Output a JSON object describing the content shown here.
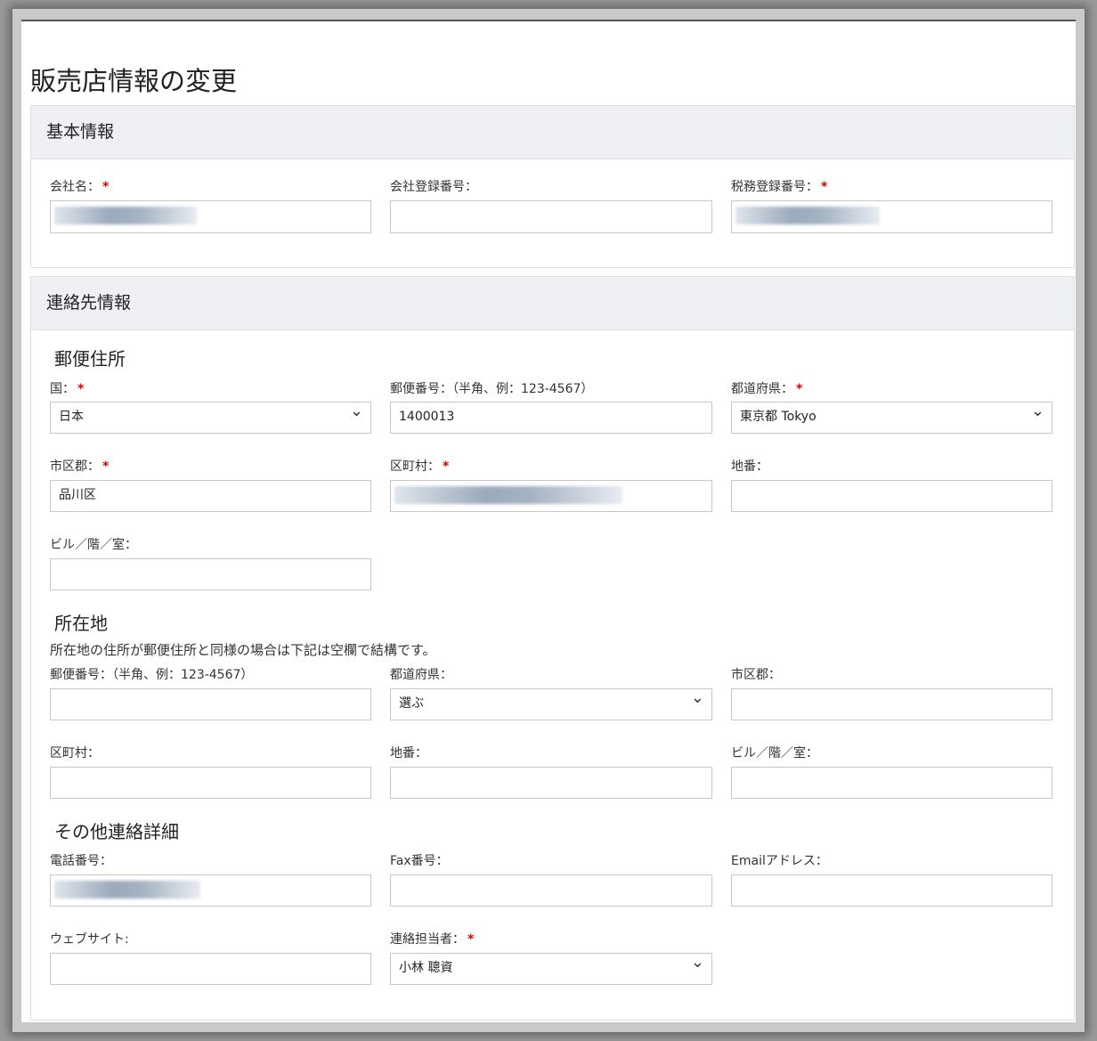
{
  "page_title": "販売店情報の変更",
  "basic": {
    "heading": "基本情報",
    "company_name": {
      "label": "会社名：",
      "value": ""
    },
    "company_reg_no": {
      "label": "会社登録番号：",
      "value": ""
    },
    "tax_reg_no": {
      "label": "税務登録番号：",
      "value": ""
    }
  },
  "contact": {
    "heading": "連絡先情報",
    "postal": {
      "heading": "郵便住所",
      "country": {
        "label": "国：",
        "value": "日本"
      },
      "zip": {
        "label": "郵便番号：（半角、例：123-4567）",
        "value": "1400013"
      },
      "prefecture": {
        "label": "都道府県：",
        "value": "東京都 Tokyo"
      },
      "city": {
        "label": "市区郡：",
        "value": "品川区"
      },
      "town": {
        "label": "区町村：",
        "value": ""
      },
      "block": {
        "label": "地番：",
        "value": ""
      },
      "building": {
        "label": "ビル／階／室：",
        "value": ""
      }
    },
    "location": {
      "heading": "所在地",
      "note": "所在地の住所が郵便住所と同様の場合は下記は空欄で結構です。",
      "zip": {
        "label": "郵便番号：（半角、例：123-4567）",
        "value": ""
      },
      "prefecture": {
        "label": "都道府県：",
        "value": "選ぶ"
      },
      "city": {
        "label": "市区郡：",
        "value": ""
      },
      "town": {
        "label": "区町村：",
        "value": ""
      },
      "block": {
        "label": "地番：",
        "value": ""
      },
      "building": {
        "label": "ビル／階／室：",
        "value": ""
      }
    },
    "other": {
      "heading": "その他連絡詳細",
      "phone": {
        "label": "電話番号：",
        "value": ""
      },
      "fax": {
        "label": "Fax番号：",
        "value": ""
      },
      "email": {
        "label": "Emailアドレス：",
        "value": ""
      },
      "website": {
        "label": "ウェブサイト:",
        "value": ""
      },
      "contact_person": {
        "label": "連絡担当者：",
        "value": "小林 聰資"
      }
    }
  },
  "required_mark": "*"
}
